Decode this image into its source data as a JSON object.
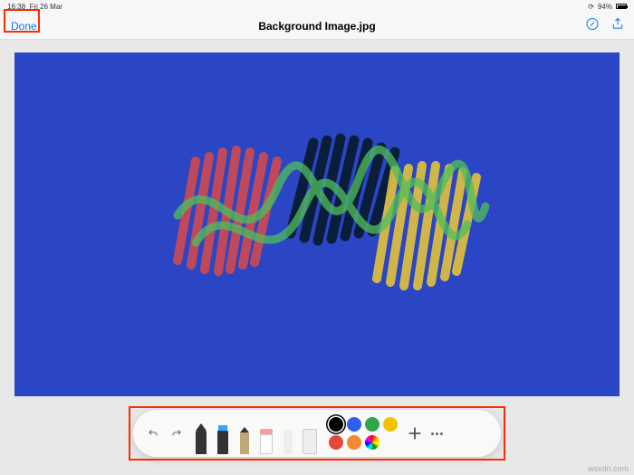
{
  "statusbar": {
    "time": "16:38",
    "date": "Fri 26 Mar",
    "battery_pct": "94%"
  },
  "navbar": {
    "title": "Background Image.jpg",
    "done_label": "Done"
  },
  "canvas": {
    "bg_color": "#2a46c4"
  },
  "toolbar": {
    "tools": [
      "pen",
      "marker",
      "pencil",
      "eraser",
      "lasso",
      "ruler"
    ],
    "colors": [
      {
        "name": "black",
        "hex": "#000000",
        "selected": true
      },
      {
        "name": "blue",
        "hex": "#2f5ef0"
      },
      {
        "name": "green",
        "hex": "#2fa84a"
      },
      {
        "name": "yellow",
        "hex": "#f2c200"
      },
      {
        "name": "red",
        "hex": "#e14a3a"
      },
      {
        "name": "orange",
        "hex": "#f08b2f"
      },
      {
        "name": "rainbow",
        "hex": "rainbow"
      }
    ]
  },
  "watermark": "wsxdn.com"
}
